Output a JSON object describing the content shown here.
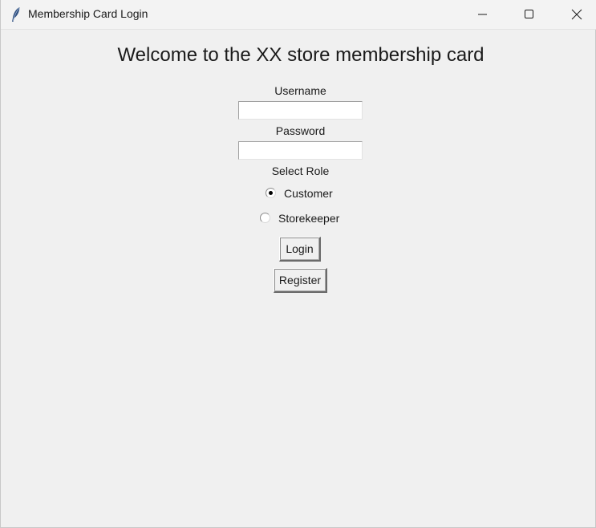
{
  "window": {
    "title": "Membership Card Login",
    "app_icon": "feather-icon",
    "controls": [
      "minimize-icon",
      "maximize-icon",
      "close-icon"
    ]
  },
  "form": {
    "heading": "Welcome to the XX store membership card",
    "username_label": "Username",
    "username_value": "",
    "password_label": "Password",
    "password_value": "",
    "role_label": "Select Role",
    "roles": [
      {
        "label": "Customer",
        "selected": true
      },
      {
        "label": "Storekeeper",
        "selected": false
      }
    ],
    "login_label": "Login",
    "register_label": "Register"
  }
}
